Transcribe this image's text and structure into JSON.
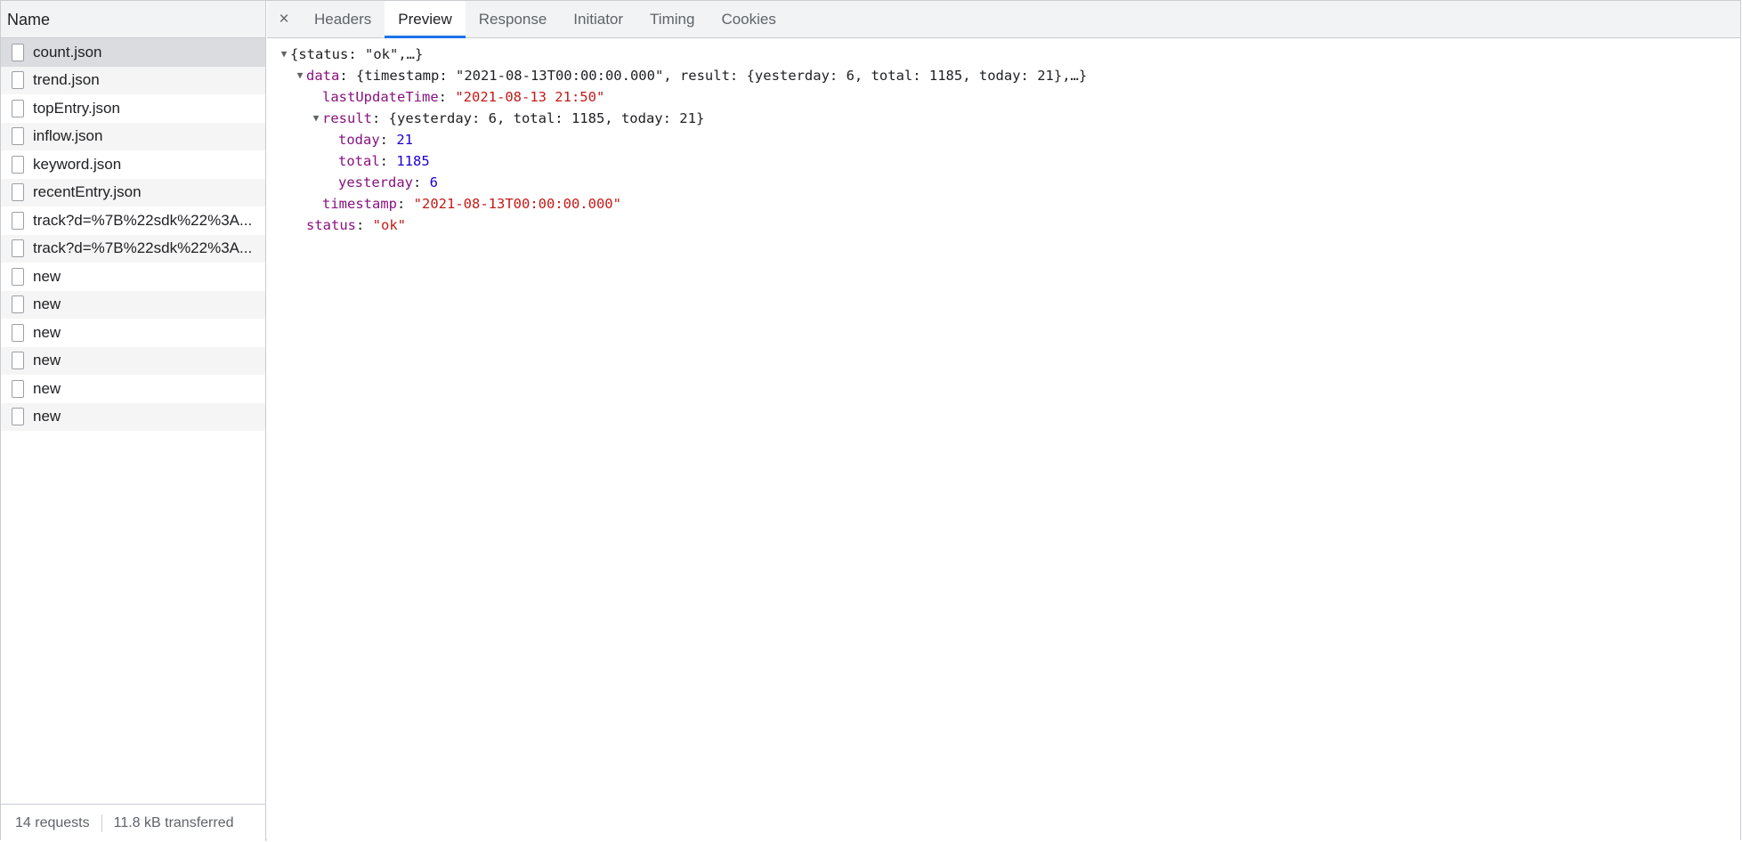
{
  "left_panel": {
    "header": "Name",
    "requests": [
      {
        "name": "count.json"
      },
      {
        "name": "trend.json"
      },
      {
        "name": "topEntry.json"
      },
      {
        "name": "inflow.json"
      },
      {
        "name": "keyword.json"
      },
      {
        "name": "recentEntry.json"
      },
      {
        "name": "track?d=%7B%22sdk%22%3A..."
      },
      {
        "name": "track?d=%7B%22sdk%22%3A..."
      },
      {
        "name": "new"
      },
      {
        "name": "new"
      },
      {
        "name": "new"
      },
      {
        "name": "new"
      },
      {
        "name": "new"
      },
      {
        "name": "new"
      }
    ],
    "selected_index": 0,
    "status": {
      "requests": "14 requests",
      "transferred": "11.8 kB transferred"
    }
  },
  "tabs": {
    "close_glyph": "×",
    "items": [
      "Headers",
      "Preview",
      "Response",
      "Initiator",
      "Timing",
      "Cookies"
    ],
    "active": "Preview"
  },
  "preview": {
    "root_summary": "{status: \"ok\",…}",
    "data_key": "data",
    "data_summary": "{timestamp: \"2021-08-13T00:00:00.000\", result: {yesterday: 6, total: 1185, today: 21},…}",
    "lastUpdateTime_key": "lastUpdateTime",
    "lastUpdateTime_value": "\"2021-08-13 21:50\"",
    "result_key": "result",
    "result_summary": "{yesterday: 6, total: 1185, today: 21}",
    "today_key": "today",
    "today_value": "21",
    "total_key": "total",
    "total_value": "1185",
    "yesterday_key": "yesterday",
    "yesterday_value": "6",
    "timestamp_key": "timestamp",
    "timestamp_value": "\"2021-08-13T00:00:00.000\"",
    "status_key": "status",
    "status_value": "\"ok\""
  },
  "colors": {
    "key": "#881280",
    "string": "#c41a16",
    "number": "#1c00cf",
    "active_tab_underline": "#1a73e8"
  }
}
